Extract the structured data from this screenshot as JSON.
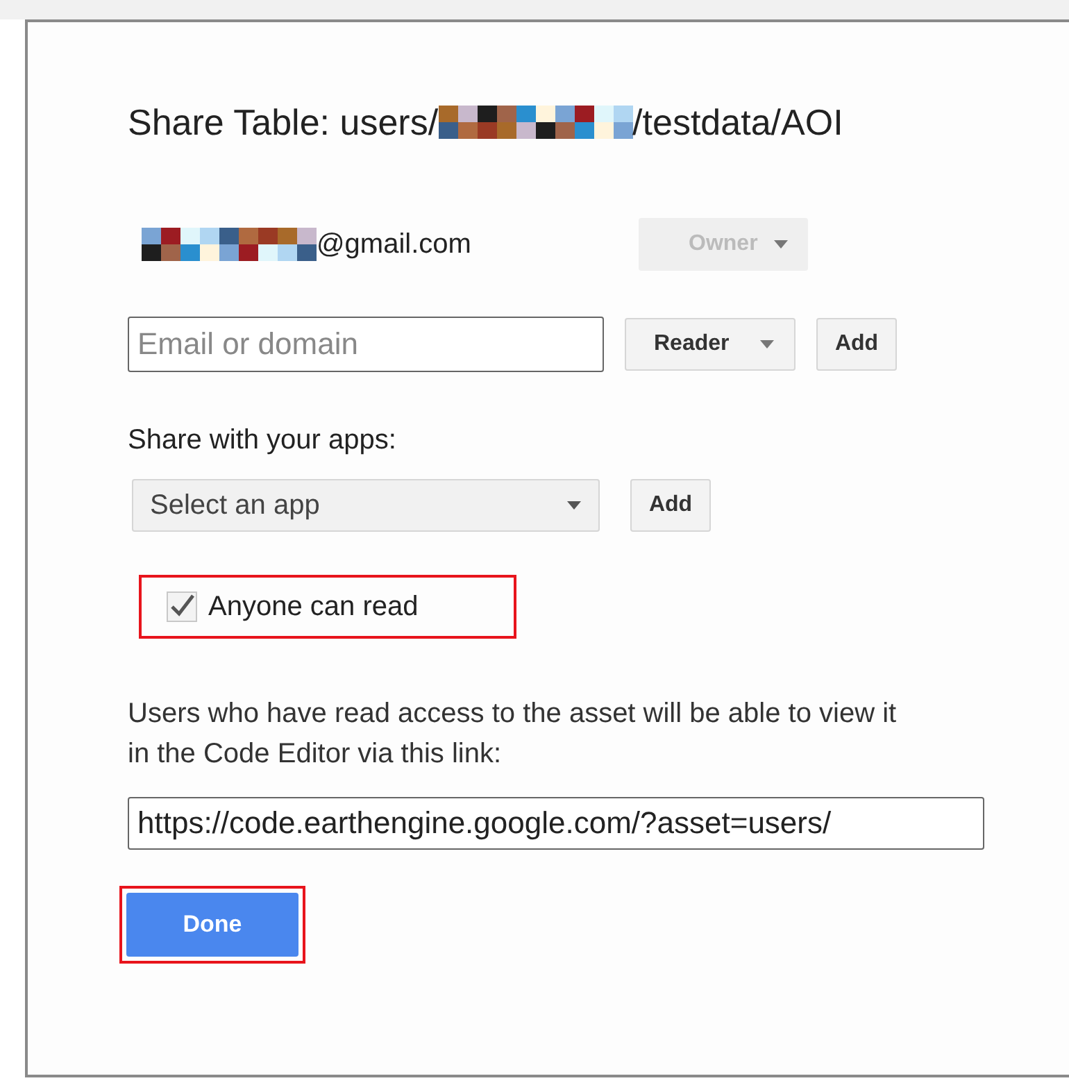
{
  "dialog": {
    "title_prefix": "Share Table: users/",
    "title_suffix": "/testdata/AOI"
  },
  "owner": {
    "email_suffix": "@gmail.com",
    "role": "Owner",
    "disabled": true
  },
  "add_user": {
    "placeholder": "Email or domain",
    "role": "Reader",
    "button": "Add"
  },
  "apps": {
    "label": "Share with your apps:",
    "placeholder": "Select an app",
    "button": "Add"
  },
  "anyone_can_read": {
    "label": "Anyone can read",
    "checked": true,
    "highlighted": true
  },
  "info": "Users who have read access to the asset will be able to view it in the Code Editor via this link:",
  "link": {
    "value": "https://code.earthengine.google.com/?asset=users/"
  },
  "done": {
    "label": "Done",
    "highlighted": true
  }
}
